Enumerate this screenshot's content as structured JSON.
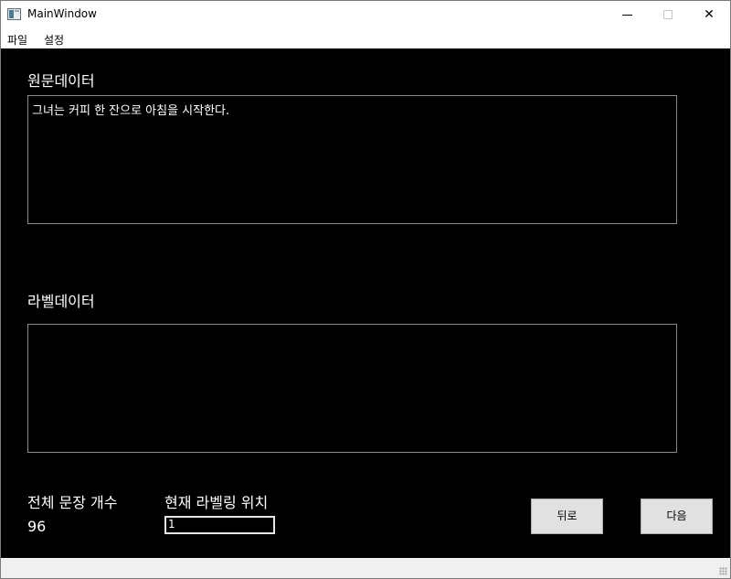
{
  "window": {
    "title": "MainWindow"
  },
  "menu": {
    "items": [
      "파일",
      "설정"
    ]
  },
  "source": {
    "label": "원문데이터",
    "text": "그녀는 커피 한 잔으로 아침을 시작한다."
  },
  "labeled": {
    "label": "라벨데이터",
    "text": ""
  },
  "stats": {
    "total_label": "전체 문장 개수",
    "total_value": "96",
    "position_label": "현재 라벨링 위치",
    "position_value": "1"
  },
  "buttons": {
    "back": "뒤로",
    "next": "다음"
  },
  "icons": {
    "app": "app-window-icon",
    "minimize": "minimize-icon",
    "maximize": "maximize-icon",
    "close": "close-icon",
    "grip": "resize-grip-icon"
  }
}
